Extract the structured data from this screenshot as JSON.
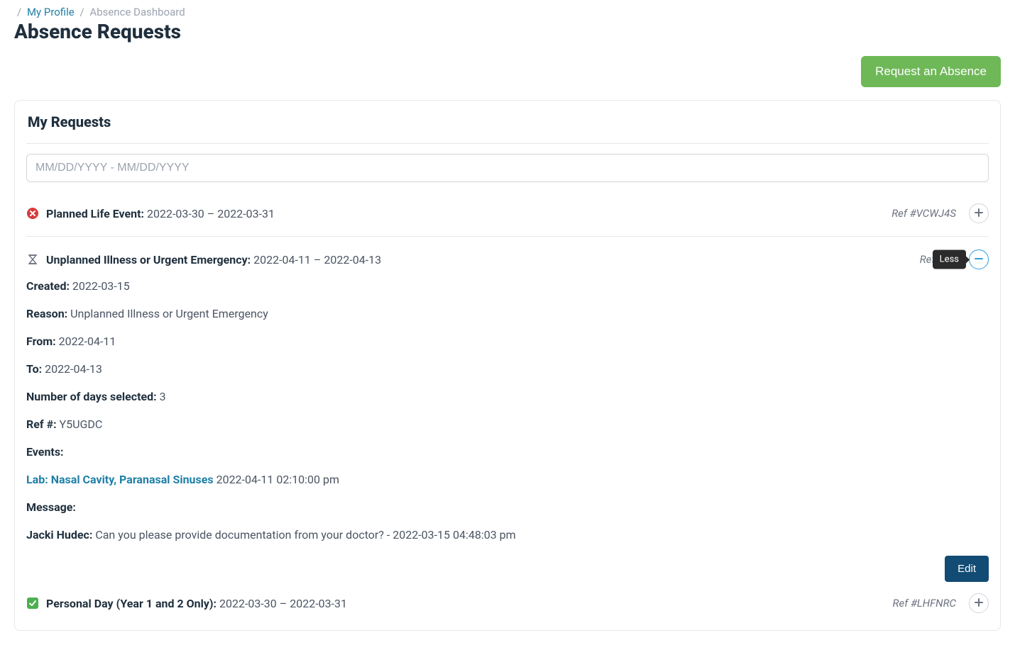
{
  "breadcrumb": {
    "items": [
      {
        "label": "My Profile",
        "link": true
      },
      {
        "label": "Absence Dashboard",
        "link": false
      }
    ]
  },
  "page": {
    "title": "Absence Requests"
  },
  "actions": {
    "request_label": "Request an Absence"
  },
  "panel": {
    "title": "My Requests",
    "filter_placeholder": "MM/DD/YYYY - MM/DD/YYYY"
  },
  "tooltip": {
    "less": "Less"
  },
  "buttons": {
    "edit": "Edit"
  },
  "requests": [
    {
      "status": "declined",
      "type_label": "Planned Life Event:",
      "date_range": "2022-03-30 – 2022-03-31",
      "ref_display": "Ref #VCWJ4S",
      "expanded": false
    },
    {
      "status": "pending",
      "type_label": "Unplanned Illness or Urgent Emergency:",
      "date_range": "2022-04-11 – 2022-04-13",
      "ref_display": "Ref #Y5",
      "expanded": true,
      "details": {
        "created_label": "Created:",
        "created_value": "2022-03-15",
        "reason_label": "Reason:",
        "reason_value": "Unplanned Illness or Urgent Emergency",
        "from_label": "From:",
        "from_value": "2022-04-11",
        "to_label": "To:",
        "to_value": "2022-04-13",
        "days_label": "Number of days selected:",
        "days_value": "3",
        "ref_label": "Ref #:",
        "ref_value": "Y5UGDC",
        "events_label": "Events:",
        "event_link_text": "Lab: Nasal Cavity, Paranasal Sinuses",
        "event_time": "2022-04-11 02:10:00 pm",
        "message_label": "Message:",
        "message_author": "Jacki Hudec:",
        "message_text": "Can you please provide documentation from your doctor? - 2022-03-15 04:48:03 pm"
      }
    },
    {
      "status": "approved",
      "type_label": "Personal Day (Year 1 and 2 Only):",
      "date_range": "2022-03-30 – 2022-03-31",
      "ref_display": "Ref #LHFNRC",
      "expanded": false
    }
  ]
}
